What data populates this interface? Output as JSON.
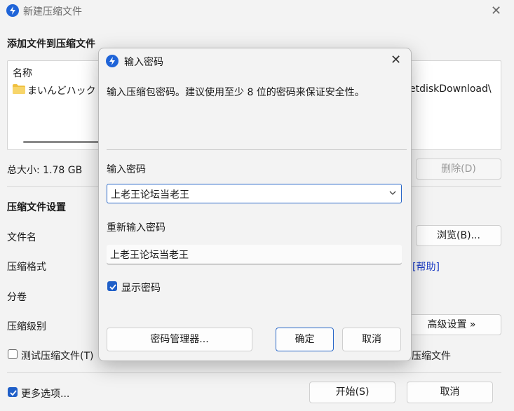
{
  "main_window": {
    "title": "新建压缩文件",
    "close_glyph": "✕",
    "add_files_heading": "添加文件到压缩文件",
    "file_list": {
      "column_header": "名称",
      "items": [
        {
          "name": "まいんどハック",
          "path": "etdiskDownload\\"
        }
      ]
    },
    "total_size": "总大小: 1.78 GB",
    "delete_button": "删除(D)",
    "settings_heading": "压缩文件设置",
    "filename_label": "文件名",
    "browse_button": "浏览(B)...",
    "format_label": "压缩格式",
    "help_link": "[帮助]",
    "split_label": "分卷",
    "level_label": "压缩级别",
    "advanced_button": "高级设置 »",
    "test_archive_checkbox": "测试压缩文件(T)",
    "test_archive_checked": false,
    "right_partial_label": "压缩文件",
    "more_options_checkbox": "更多选项...",
    "more_options_checked": true,
    "start_button": "开始(S)",
    "cancel_button": "取消"
  },
  "dialog": {
    "title": "输入密码",
    "close_glyph": "✕",
    "description": "输入压缩包密码。建议使用至少 8 位的密码来保证安全性。",
    "password_label": "输入密码",
    "password_value": "上老王论坛当老王",
    "reenter_label": "重新输入密码",
    "reenter_value": "上老王论坛当老王",
    "show_password_label": "显示密码",
    "show_password_checked": true,
    "manager_button": "密码管理器...",
    "ok_button": "确定",
    "cancel_button": "取消"
  },
  "colors": {
    "accent": "#1f5fc8",
    "link": "#1c3cc4",
    "app_icon": "#1f64d8",
    "window_bg": "#f3f3f3"
  },
  "icons": {
    "app": "app-logo-icon",
    "folder": "folder-icon",
    "close": "close-icon",
    "chevron": "chevron-down-icon",
    "check": "check-icon"
  }
}
